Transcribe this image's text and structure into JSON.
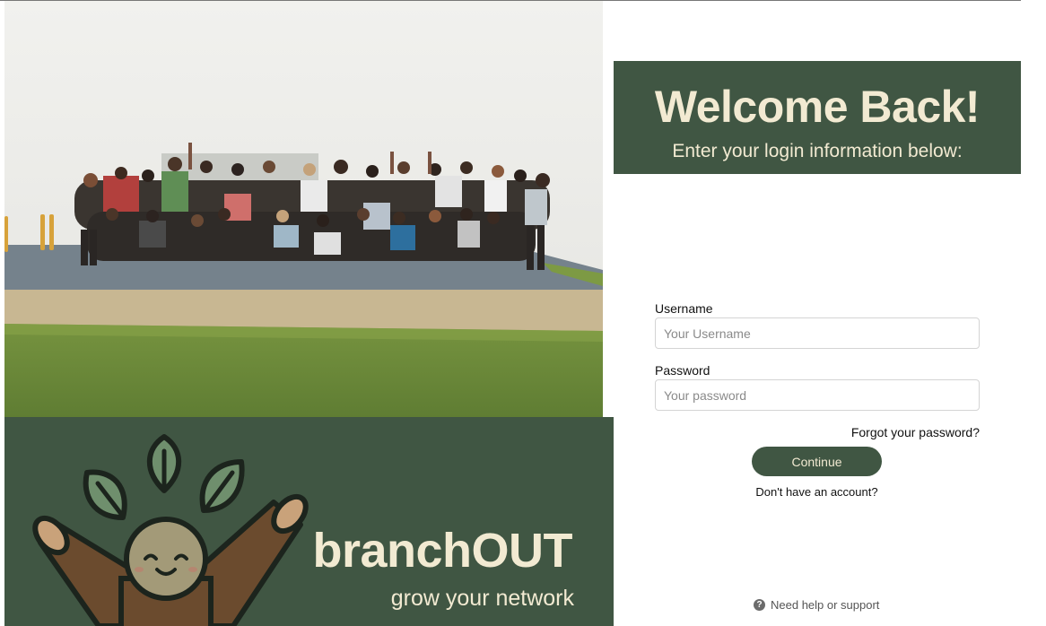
{
  "brand": {
    "name": "branchOUT",
    "tagline": "grow your network"
  },
  "login": {
    "title": "Welcome Back!",
    "subtitle": "Enter your login information below:",
    "username_label": "Username",
    "username_placeholder": "Your Username",
    "username_value": "",
    "password_label": "Password",
    "password_placeholder": "Your password",
    "password_value": "",
    "forgot_link": "Forgot your password?",
    "continue_button": "Continue",
    "signup_link": "Don't have an account?",
    "help_link": "Need help or support",
    "help_icon": "question-circle-icon"
  },
  "colors": {
    "brand_green": "#405643",
    "cream": "#f2ead2",
    "mascot_brown": "#6b4b2e",
    "leaf_green": "#6f8f6d"
  }
}
